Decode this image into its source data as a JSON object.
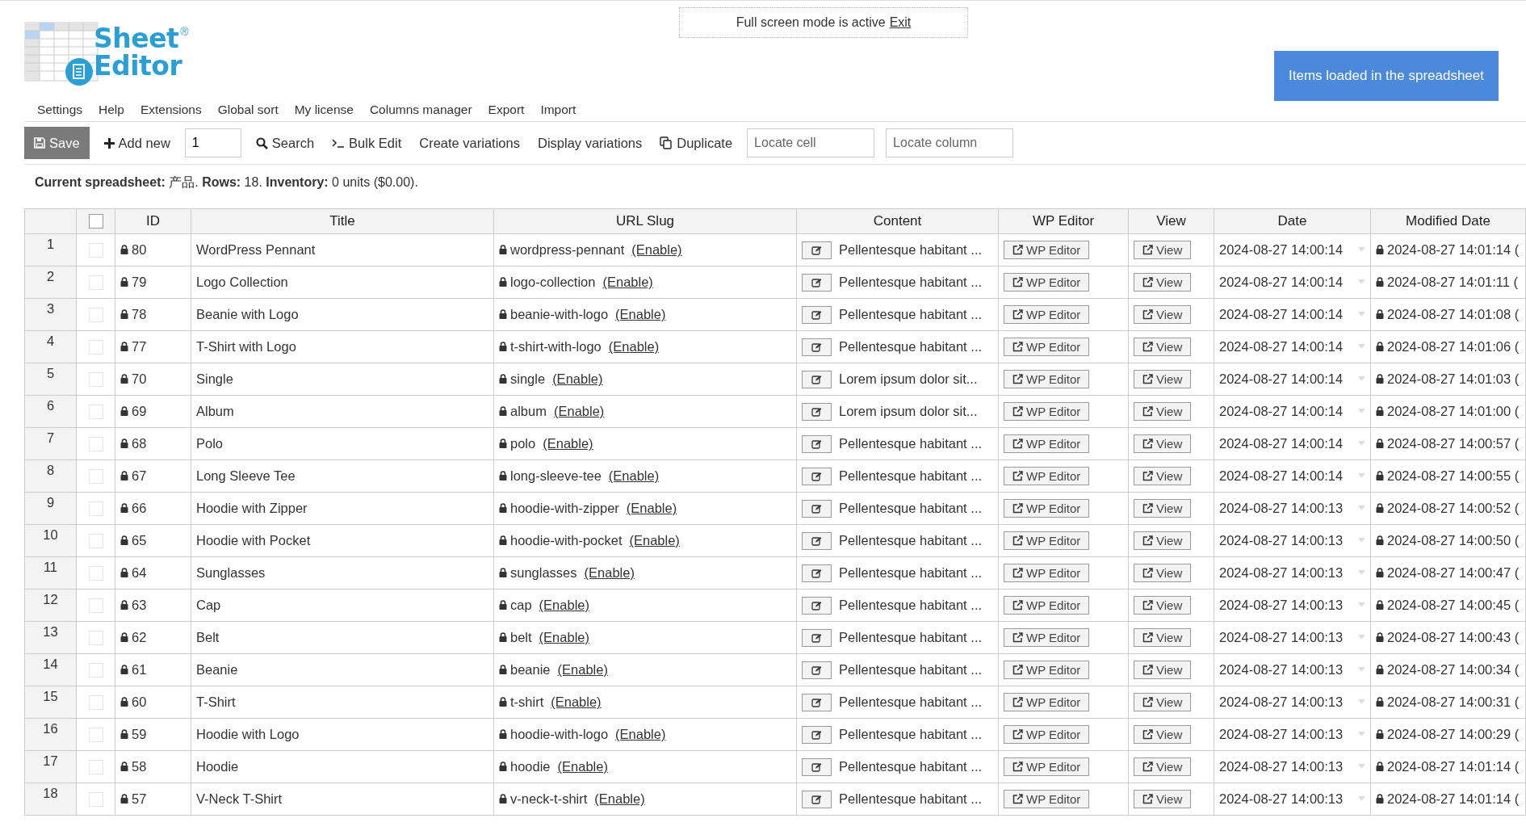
{
  "fullscreen_notice": {
    "text": "Full screen mode is active",
    "link": "Exit"
  },
  "logo": {
    "line1": "Sheet",
    "line2": "Editor",
    "mark": "®"
  },
  "items_loaded_button": "Items loaded in the spreadsheet",
  "menu": [
    "Settings",
    "Help",
    "Extensions",
    "Global sort",
    "My license",
    "Columns manager",
    "Export",
    "Import"
  ],
  "toolbar": {
    "save": "Save",
    "add_new": "Add new",
    "add_count": "1",
    "search": "Search",
    "bulk_edit": "Bulk Edit",
    "create_variations": "Create variations",
    "display_variations": "Display variations",
    "duplicate": "Duplicate",
    "locate_cell_placeholder": "Locate cell",
    "locate_column_placeholder": "Locate column"
  },
  "summary": "**Current spreadsheet:** 产品. **Rows:** 18. **Inventory:** 0 units ($0.00).",
  "table": {
    "select_all_checked": false,
    "columns": [
      "ID",
      "Title",
      "URL Slug",
      "Content",
      "WP Editor",
      "View",
      "Date",
      "Modified Date"
    ],
    "rows": [
      {
        "num": "1",
        "checked": false,
        "id": "80",
        "title": "WordPress Pennant",
        "slug": "wordpress-pennant",
        "enable": "(Enable)",
        "content": "Pellentesque habitant ...",
        "wp_editor": "WP Editor",
        "view": "View",
        "date": "2024-08-27 14:00:14",
        "modified": "2024-08-27 14:01:14 ("
      },
      {
        "num": "2",
        "checked": false,
        "id": "79",
        "title": "Logo Collection",
        "slug": "logo-collection",
        "enable": "(Enable)",
        "content": "Pellentesque habitant ...",
        "wp_editor": "WP Editor",
        "view": "View",
        "date": "2024-08-27 14:00:14",
        "modified": "2024-08-27 14:01:11 ("
      },
      {
        "num": "3",
        "checked": false,
        "id": "78",
        "title": "Beanie with Logo",
        "slug": "beanie-with-logo",
        "enable": "(Enable)",
        "content": "Pellentesque habitant ...",
        "wp_editor": "WP Editor",
        "view": "View",
        "date": "2024-08-27 14:00:14",
        "modified": "2024-08-27 14:01:08 ("
      },
      {
        "num": "4",
        "checked": false,
        "id": "77",
        "title": "T-Shirt with Logo",
        "slug": "t-shirt-with-logo",
        "enable": "(Enable)",
        "content": "Pellentesque habitant ...",
        "wp_editor": "WP Editor",
        "view": "View",
        "date": "2024-08-27 14:00:14",
        "modified": "2024-08-27 14:01:06 ("
      },
      {
        "num": "5",
        "checked": false,
        "id": "70",
        "title": "Single",
        "slug": "single",
        "enable": "(Enable)",
        "content": "Lorem ipsum dolor sit...",
        "wp_editor": "WP Editor",
        "view": "View",
        "date": "2024-08-27 14:00:14",
        "modified": "2024-08-27 14:01:03 ("
      },
      {
        "num": "6",
        "checked": false,
        "id": "69",
        "title": "Album",
        "slug": "album",
        "enable": "(Enable)",
        "content": "Lorem ipsum dolor sit...",
        "wp_editor": "WP Editor",
        "view": "View",
        "date": "2024-08-27 14:00:14",
        "modified": "2024-08-27 14:01:00 ("
      },
      {
        "num": "7",
        "checked": false,
        "id": "68",
        "title": "Polo",
        "slug": "polo",
        "enable": "(Enable)",
        "content": "Pellentesque habitant ...",
        "wp_editor": "WP Editor",
        "view": "View",
        "date": "2024-08-27 14:00:14",
        "modified": "2024-08-27 14:00:57 ("
      },
      {
        "num": "8",
        "checked": false,
        "id": "67",
        "title": "Long Sleeve Tee",
        "slug": "long-sleeve-tee",
        "enable": "(Enable)",
        "content": "Pellentesque habitant ...",
        "wp_editor": "WP Editor",
        "view": "View",
        "date": "2024-08-27 14:00:14",
        "modified": "2024-08-27 14:00:55 ("
      },
      {
        "num": "9",
        "checked": false,
        "id": "66",
        "title": "Hoodie with Zipper",
        "slug": "hoodie-with-zipper",
        "enable": "(Enable)",
        "content": "Pellentesque habitant ...",
        "wp_editor": "WP Editor",
        "view": "View",
        "date": "2024-08-27 14:00:13",
        "modified": "2024-08-27 14:00:52 ("
      },
      {
        "num": "10",
        "checked": false,
        "id": "65",
        "title": "Hoodie with Pocket",
        "slug": "hoodie-with-pocket",
        "enable": "(Enable)",
        "content": "Pellentesque habitant ...",
        "wp_editor": "WP Editor",
        "view": "View",
        "date": "2024-08-27 14:00:13",
        "modified": "2024-08-27 14:00:50 ("
      },
      {
        "num": "11",
        "checked": false,
        "id": "64",
        "title": "Sunglasses",
        "slug": "sunglasses",
        "enable": "(Enable)",
        "content": "Pellentesque habitant ...",
        "wp_editor": "WP Editor",
        "view": "View",
        "date": "2024-08-27 14:00:13",
        "modified": "2024-08-27 14:00:47 ("
      },
      {
        "num": "12",
        "checked": false,
        "id": "63",
        "title": "Cap",
        "slug": "cap",
        "enable": "(Enable)",
        "content": "Pellentesque habitant ...",
        "wp_editor": "WP Editor",
        "view": "View",
        "date": "2024-08-27 14:00:13",
        "modified": "2024-08-27 14:00:45 ("
      },
      {
        "num": "13",
        "checked": false,
        "id": "62",
        "title": "Belt",
        "slug": "belt",
        "enable": "(Enable)",
        "content": "Pellentesque habitant ...",
        "wp_editor": "WP Editor",
        "view": "View",
        "date": "2024-08-27 14:00:13",
        "modified": "2024-08-27 14:00:43 ("
      },
      {
        "num": "14",
        "checked": false,
        "id": "61",
        "title": "Beanie",
        "slug": "beanie",
        "enable": "(Enable)",
        "content": "Pellentesque habitant ...",
        "wp_editor": "WP Editor",
        "view": "View",
        "date": "2024-08-27 14:00:13",
        "modified": "2024-08-27 14:00:34 ("
      },
      {
        "num": "15",
        "checked": false,
        "id": "60",
        "title": "T-Shirt",
        "slug": "t-shirt",
        "enable": "(Enable)",
        "content": "Pellentesque habitant ...",
        "wp_editor": "WP Editor",
        "view": "View",
        "date": "2024-08-27 14:00:13",
        "modified": "2024-08-27 14:00:31 ("
      },
      {
        "num": "16",
        "checked": false,
        "id": "59",
        "title": "Hoodie with Logo",
        "slug": "hoodie-with-logo",
        "enable": "(Enable)",
        "content": "Pellentesque habitant ...",
        "wp_editor": "WP Editor",
        "view": "View",
        "date": "2024-08-27 14:00:13",
        "modified": "2024-08-27 14:00:29 ("
      },
      {
        "num": "17",
        "checked": false,
        "id": "58",
        "title": "Hoodie",
        "slug": "hoodie",
        "enable": "(Enable)",
        "content": "Pellentesque habitant ...",
        "wp_editor": "WP Editor",
        "view": "View",
        "date": "2024-08-27 14:00:13",
        "modified": "2024-08-27 14:01:14 ("
      },
      {
        "num": "18",
        "checked": false,
        "id": "57",
        "title": "V-Neck T-Shirt",
        "slug": "v-neck-t-shirt",
        "enable": "(Enable)",
        "content": "Pellentesque habitant ...",
        "wp_editor": "WP Editor",
        "view": "View",
        "date": "2024-08-27 14:00:13",
        "modified": "2024-08-27 14:01:14 ("
      }
    ]
  }
}
